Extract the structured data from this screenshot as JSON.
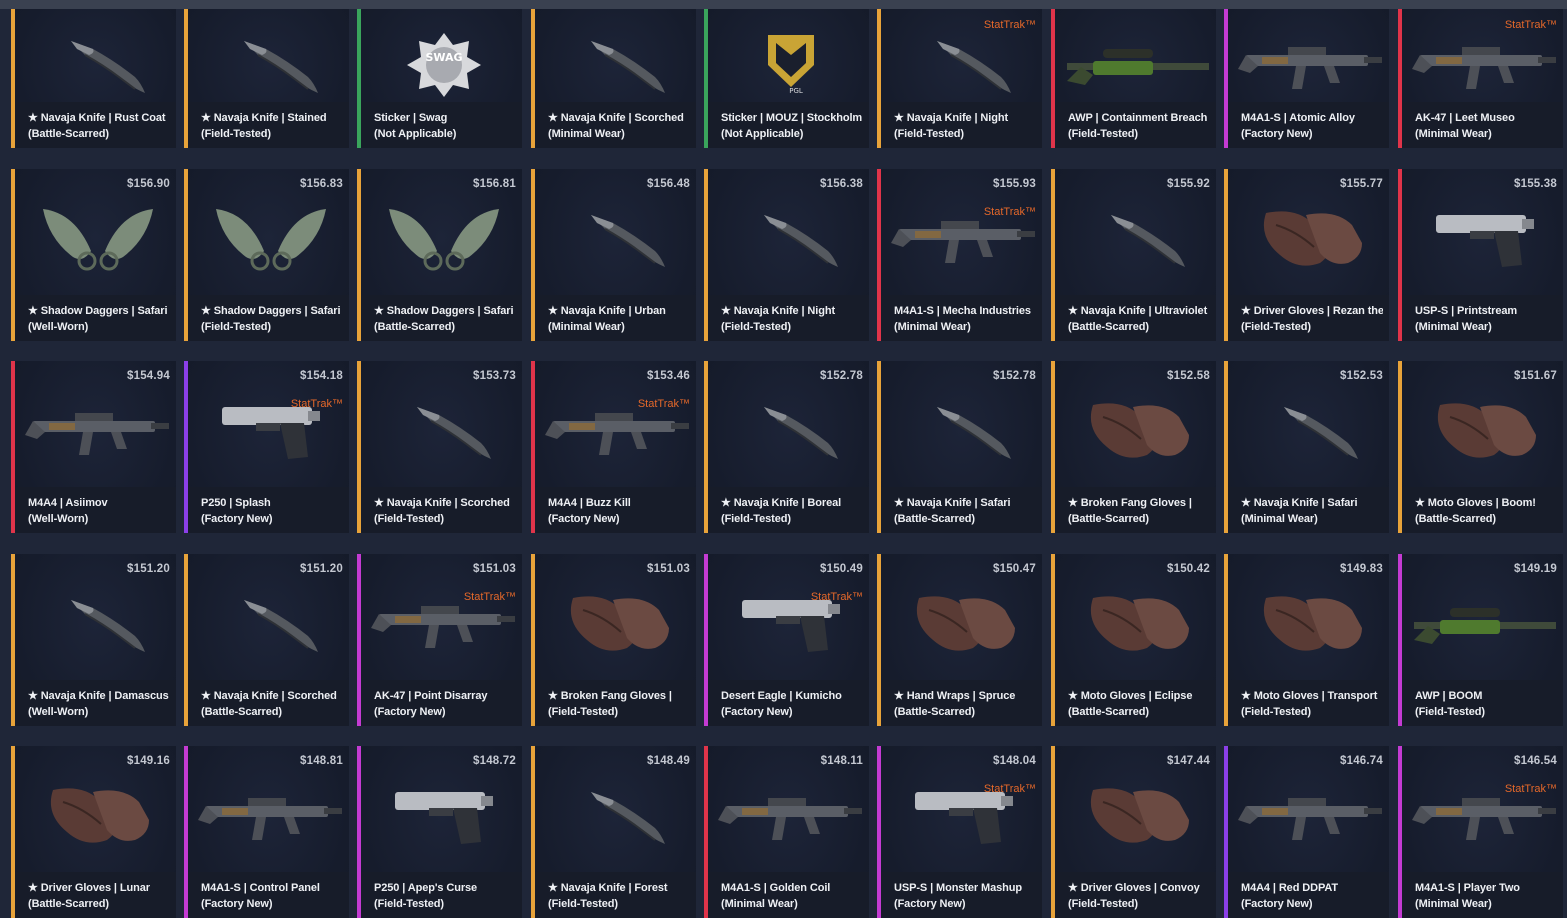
{
  "colors": {
    "background": "#1f2638",
    "card_bg": "#161c2c",
    "label_bg": "#171c29",
    "text": "#eef0f4",
    "price": "#c4c8d1",
    "stattrak": "#e4682a",
    "rarity": {
      "gold": "#e8a33a",
      "green": "#3aa55c",
      "red": "#e0344a",
      "pink": "#c43bd3",
      "purple": "#8b3fe8"
    }
  },
  "items": [
    {
      "name": "★ Navaja Knife | Rust Coat",
      "wear": "(Battle-Scarred)",
      "price": "",
      "stattrak": "",
      "rarity": "gold",
      "icon": "knife-icon"
    },
    {
      "name": "★ Navaja Knife | Stained",
      "wear": "(Field-Tested)",
      "price": "",
      "stattrak": "",
      "rarity": "gold",
      "icon": "knife-icon"
    },
    {
      "name": "Sticker | Swag",
      "wear": "(Not Applicable)",
      "price": "",
      "stattrak": "",
      "rarity": "green",
      "icon": "sticker-swag-icon",
      "logo": "SWAG"
    },
    {
      "name": "★ Navaja Knife | Scorched",
      "wear": "(Minimal Wear)",
      "price": "",
      "stattrak": "",
      "rarity": "gold",
      "icon": "knife-icon"
    },
    {
      "name": "Sticker | MOUZ | Stockholm",
      "wear": "(Not Applicable)",
      "price": "",
      "stattrak": "",
      "rarity": "green",
      "icon": "sticker-mouz-icon",
      "logo": "PGL"
    },
    {
      "name": "★ Navaja Knife | Night",
      "wear": "(Field-Tested)",
      "price": "",
      "stattrak": "StatTrak™",
      "rarity": "gold",
      "icon": "knife-icon"
    },
    {
      "name": "AWP | Containment Breach",
      "wear": "(Field-Tested)",
      "price": "",
      "stattrak": "",
      "rarity": "red",
      "icon": "sniper-rifle-icon"
    },
    {
      "name": "M4A1-S | Atomic Alloy",
      "wear": "(Factory New)",
      "price": "",
      "stattrak": "",
      "rarity": "pink",
      "icon": "rifle-icon"
    },
    {
      "name": "AK-47 | Leet Museo",
      "wear": "(Minimal Wear)",
      "price": "",
      "stattrak": "StatTrak™",
      "rarity": "red",
      "icon": "rifle-icon"
    },
    {
      "name": "★ Shadow Daggers | Safari",
      "wear": "(Well-Worn)",
      "price": "$156.90",
      "stattrak": "",
      "rarity": "gold",
      "icon": "daggers-icon"
    },
    {
      "name": "★ Shadow Daggers | Safari",
      "wear": "(Field-Tested)",
      "price": "$156.83",
      "stattrak": "",
      "rarity": "gold",
      "icon": "daggers-icon"
    },
    {
      "name": "★ Shadow Daggers | Safari",
      "wear": "(Battle-Scarred)",
      "price": "$156.81",
      "stattrak": "",
      "rarity": "gold",
      "icon": "daggers-icon"
    },
    {
      "name": "★ Navaja Knife | Urban",
      "wear": "(Minimal Wear)",
      "price": "$156.48",
      "stattrak": "",
      "rarity": "gold",
      "icon": "knife-icon"
    },
    {
      "name": "★ Navaja Knife | Night",
      "wear": "(Field-Tested)",
      "price": "$156.38",
      "stattrak": "",
      "rarity": "gold",
      "icon": "knife-icon"
    },
    {
      "name": "M4A1-S | Mecha Industries",
      "wear": "(Minimal Wear)",
      "price": "$155.93",
      "stattrak": "StatTrak™",
      "rarity": "red",
      "icon": "rifle-icon"
    },
    {
      "name": "★ Navaja Knife | Ultraviolet",
      "wear": "(Battle-Scarred)",
      "price": "$155.92",
      "stattrak": "",
      "rarity": "gold",
      "icon": "knife-icon"
    },
    {
      "name": "★ Driver Gloves | Rezan the",
      "wear": "(Field-Tested)",
      "price": "$155.77",
      "stattrak": "",
      "rarity": "gold",
      "icon": "gloves-icon"
    },
    {
      "name": "USP-S | Printstream",
      "wear": "(Minimal Wear)",
      "price": "$155.38",
      "stattrak": "",
      "rarity": "red",
      "icon": "pistol-icon"
    },
    {
      "name": "M4A4 | Asiimov",
      "wear": "(Well-Worn)",
      "price": "$154.94",
      "stattrak": "",
      "rarity": "red",
      "icon": "rifle-icon"
    },
    {
      "name": "P250 | Splash",
      "wear": "(Factory New)",
      "price": "$154.18",
      "stattrak": "StatTrak™",
      "rarity": "purple",
      "icon": "pistol-icon"
    },
    {
      "name": "★ Navaja Knife | Scorched",
      "wear": "(Field-Tested)",
      "price": "$153.73",
      "stattrak": "",
      "rarity": "gold",
      "icon": "knife-icon"
    },
    {
      "name": "M4A4 | Buzz Kill",
      "wear": "(Factory New)",
      "price": "$153.46",
      "stattrak": "StatTrak™",
      "rarity": "red",
      "icon": "rifle-icon"
    },
    {
      "name": "★ Navaja Knife | Boreal",
      "wear": "(Field-Tested)",
      "price": "$152.78",
      "stattrak": "",
      "rarity": "gold",
      "icon": "knife-icon"
    },
    {
      "name": "★ Navaja Knife | Safari",
      "wear": "(Battle-Scarred)",
      "price": "$152.78",
      "stattrak": "",
      "rarity": "gold",
      "icon": "knife-icon"
    },
    {
      "name": "★ Broken Fang Gloves |",
      "wear": "(Battle-Scarred)",
      "price": "$152.58",
      "stattrak": "",
      "rarity": "gold",
      "icon": "gloves-icon"
    },
    {
      "name": "★ Navaja Knife | Safari",
      "wear": "(Minimal Wear)",
      "price": "$152.53",
      "stattrak": "",
      "rarity": "gold",
      "icon": "knife-icon"
    },
    {
      "name": "★ Moto Gloves | Boom!",
      "wear": "(Battle-Scarred)",
      "price": "$151.67",
      "stattrak": "",
      "rarity": "gold",
      "icon": "gloves-icon"
    },
    {
      "name": "★ Navaja Knife | Damascus",
      "wear": "(Well-Worn)",
      "price": "$151.20",
      "stattrak": "",
      "rarity": "gold",
      "icon": "knife-icon"
    },
    {
      "name": "★ Navaja Knife | Scorched",
      "wear": "(Battle-Scarred)",
      "price": "$151.20",
      "stattrak": "",
      "rarity": "gold",
      "icon": "knife-icon"
    },
    {
      "name": "AK-47 | Point Disarray",
      "wear": "(Factory New)",
      "price": "$151.03",
      "stattrak": "StatTrak™",
      "rarity": "pink",
      "icon": "rifle-icon"
    },
    {
      "name": "★ Broken Fang Gloves |",
      "wear": "(Field-Tested)",
      "price": "$151.03",
      "stattrak": "",
      "rarity": "gold",
      "icon": "gloves-icon"
    },
    {
      "name": "Desert Eagle | Kumicho",
      "wear": "(Factory New)",
      "price": "$150.49",
      "stattrak": "StatTrak™",
      "rarity": "pink",
      "icon": "pistol-icon"
    },
    {
      "name": "★ Hand Wraps | Spruce",
      "wear": "(Battle-Scarred)",
      "price": "$150.47",
      "stattrak": "",
      "rarity": "gold",
      "icon": "gloves-icon"
    },
    {
      "name": "★ Moto Gloves | Eclipse",
      "wear": "(Battle-Scarred)",
      "price": "$150.42",
      "stattrak": "",
      "rarity": "gold",
      "icon": "gloves-icon"
    },
    {
      "name": "★ Moto Gloves | Transport",
      "wear": "(Field-Tested)",
      "price": "$149.83",
      "stattrak": "",
      "rarity": "gold",
      "icon": "gloves-icon"
    },
    {
      "name": "AWP | BOOM",
      "wear": "(Field-Tested)",
      "price": "$149.19",
      "stattrak": "",
      "rarity": "pink",
      "icon": "sniper-rifle-icon"
    },
    {
      "name": "★ Driver Gloves | Lunar",
      "wear": "(Battle-Scarred)",
      "price": "$149.16",
      "stattrak": "",
      "rarity": "gold",
      "icon": "gloves-icon"
    },
    {
      "name": "M4A1-S | Control Panel",
      "wear": "(Factory New)",
      "price": "$148.81",
      "stattrak": "",
      "rarity": "pink",
      "icon": "rifle-icon"
    },
    {
      "name": "P250 | Apep's Curse",
      "wear": "(Field-Tested)",
      "price": "$148.72",
      "stattrak": "",
      "rarity": "pink",
      "icon": "pistol-icon"
    },
    {
      "name": "★ Navaja Knife | Forest",
      "wear": "(Field-Tested)",
      "price": "$148.49",
      "stattrak": "",
      "rarity": "gold",
      "icon": "knife-icon"
    },
    {
      "name": "M4A1-S | Golden Coil",
      "wear": "(Minimal Wear)",
      "price": "$148.11",
      "stattrak": "",
      "rarity": "red",
      "icon": "rifle-icon"
    },
    {
      "name": "USP-S | Monster Mashup",
      "wear": "(Factory New)",
      "price": "$148.04",
      "stattrak": "StatTrak™",
      "rarity": "pink",
      "icon": "pistol-icon"
    },
    {
      "name": "★ Driver Gloves | Convoy",
      "wear": "(Field-Tested)",
      "price": "$147.44",
      "stattrak": "",
      "rarity": "gold",
      "icon": "gloves-icon"
    },
    {
      "name": "M4A4 | Red DDPAT",
      "wear": "(Factory New)",
      "price": "$146.74",
      "stattrak": "",
      "rarity": "purple",
      "icon": "rifle-icon"
    },
    {
      "name": "M4A1-S | Player Two",
      "wear": "(Minimal Wear)",
      "price": "$146.54",
      "stattrak": "StatTrak™",
      "rarity": "pink",
      "icon": "rifle-icon"
    }
  ]
}
